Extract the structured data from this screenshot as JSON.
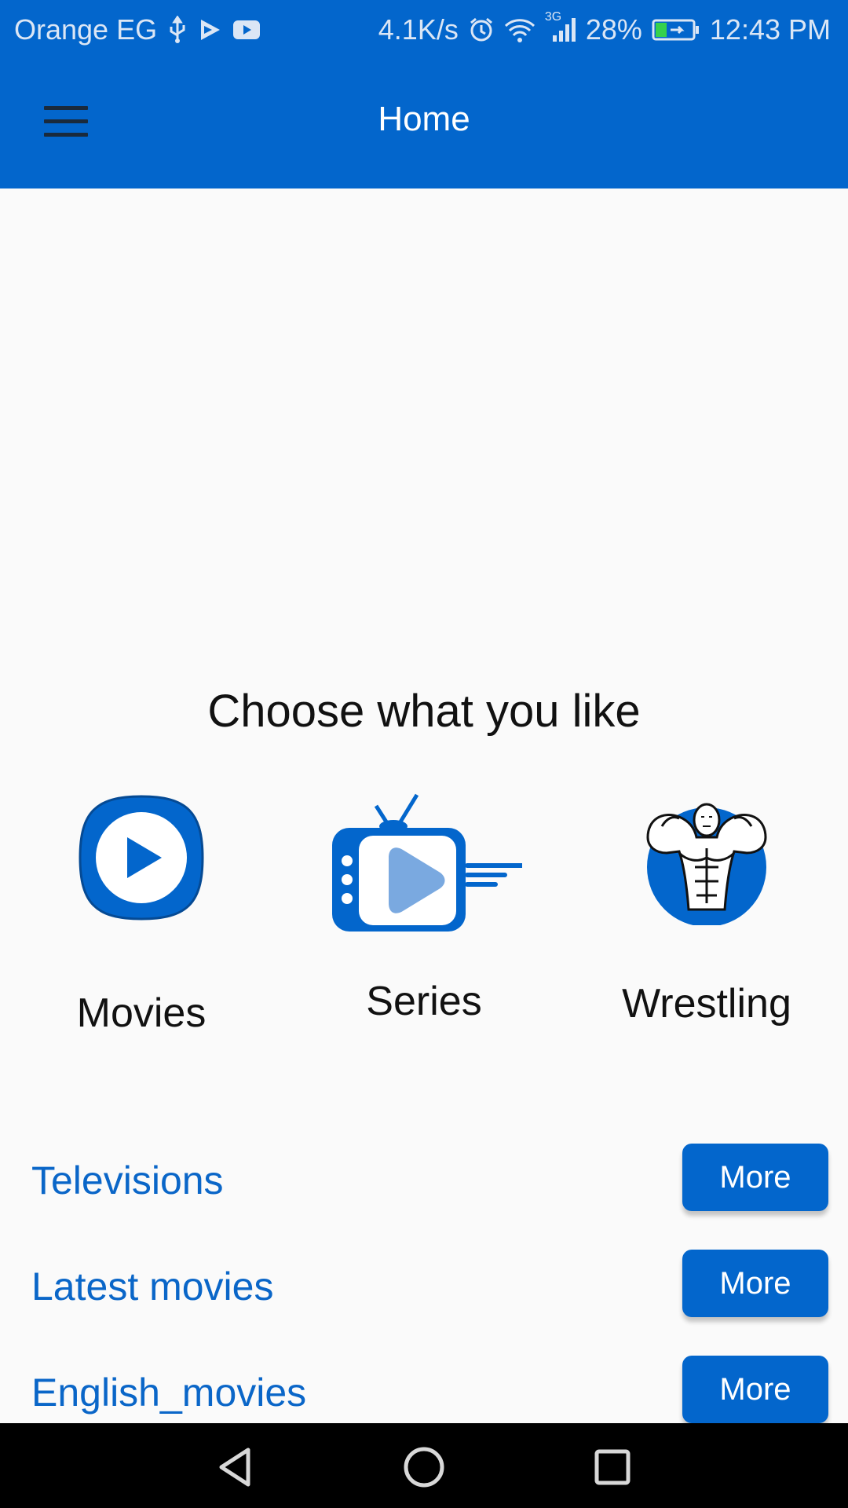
{
  "status_bar": {
    "carrier": "Orange EG",
    "net_speed": "4.1K/s",
    "network_type": "3G",
    "battery": "28%",
    "time": "12:43 PM",
    "icons": [
      "usb-icon",
      "play-store-icon",
      "youtube-icon",
      "alarm-icon",
      "wifi-icon",
      "signal-icon",
      "battery-icon"
    ]
  },
  "app_bar": {
    "title": "Home",
    "menu_icon": "hamburger-menu-icon"
  },
  "main": {
    "heading": "Choose what you like",
    "categories": [
      {
        "label": "Movies",
        "icon": "play-button-icon"
      },
      {
        "label": "Series",
        "icon": "tv-icon"
      },
      {
        "label": "Wrestling",
        "icon": "wrestler-icon"
      }
    ],
    "sections": [
      {
        "title": "Televisions",
        "button": "More"
      },
      {
        "title": "Latest movies",
        "button": "More"
      },
      {
        "title": "English_movies",
        "button": "More"
      }
    ]
  },
  "nav_bar": {
    "icons": [
      "back-icon",
      "home-icon",
      "recents-icon"
    ]
  },
  "colors": {
    "primary": "#0366cc",
    "link": "#0a66c8",
    "background": "#fafafa"
  }
}
